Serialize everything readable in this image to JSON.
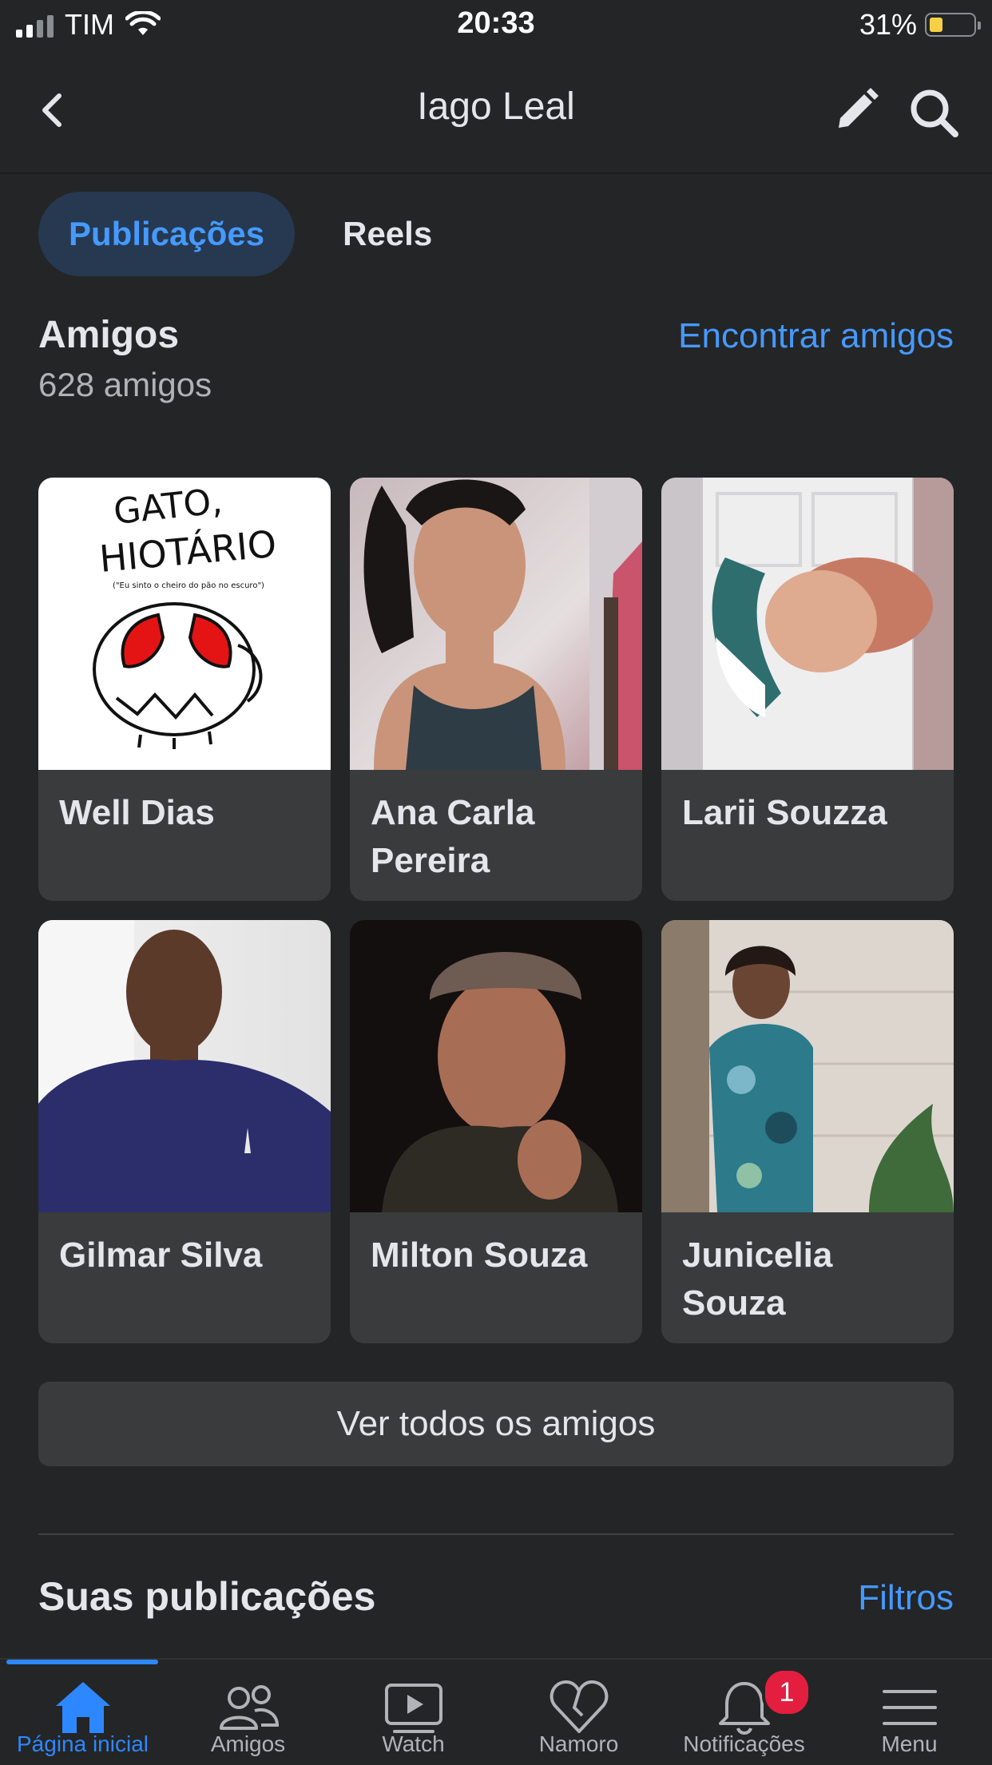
{
  "status_bar": {
    "carrier": "TIM",
    "time": "20:33",
    "battery": "31%",
    "battery_level": 0.31
  },
  "header": {
    "title": "Iago Leal"
  },
  "tabs": [
    {
      "label": "Publicações",
      "active": true
    },
    {
      "label": "Reels",
      "active": false
    }
  ],
  "friends": {
    "title": "Amigos",
    "count": "628 amigos",
    "find_label": "Encontrar amigos",
    "items": [
      {
        "name": "Well Dias"
      },
      {
        "name": "Ana Carla Pereira"
      },
      {
        "name": "Larii Souzza"
      },
      {
        "name": "Gilmar Silva"
      },
      {
        "name": "Milton Souza"
      },
      {
        "name": "Junicelia Souza"
      }
    ],
    "see_all_label": "Ver todos os amigos"
  },
  "profile_image_1": {
    "text_line1": "GATO,",
    "text_line2": "HIOTÁRIO",
    "caption": "(\"Eu sinto o cheiro do pão no escuro\")"
  },
  "posts": {
    "title": "Suas publicações",
    "filters_label": "Filtros"
  },
  "bottom_nav": [
    {
      "label": "Página inicial",
      "icon": "home-icon",
      "active": true
    },
    {
      "label": "Amigos",
      "icon": "friends-icon"
    },
    {
      "label": "Watch",
      "icon": "watch-icon"
    },
    {
      "label": "Namoro",
      "icon": "heart-icon"
    },
    {
      "label": "Notificações",
      "icon": "bell-icon",
      "badge": "1"
    },
    {
      "label": "Menu",
      "icon": "menu-icon"
    }
  ],
  "colors": {
    "accent": "#4599ff",
    "badge": "#e41e3f",
    "background": "#242526",
    "card": "#3a3b3c"
  }
}
